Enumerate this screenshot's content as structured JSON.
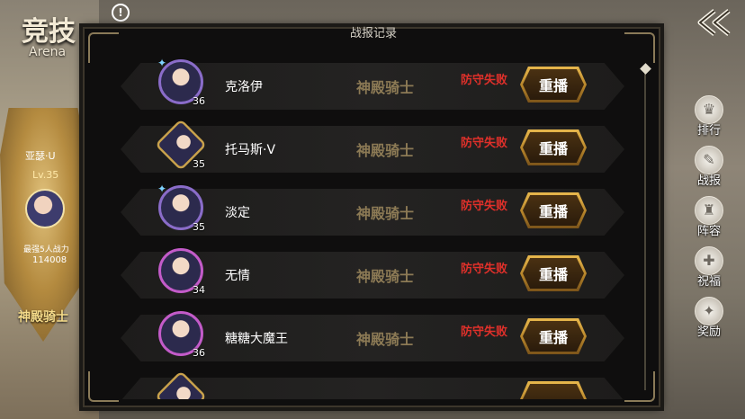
{
  "background": {
    "title": "竞技",
    "subtitle": "Arena",
    "opponent_name": "亚瑟·U",
    "opponent_level": "Lv.35",
    "power_label": "最强5人战力",
    "power_value": "114008",
    "rank_title": "神殿骑士"
  },
  "side_menu": [
    {
      "label": "排行",
      "icon": "ranking-icon",
      "glyph": "♛"
    },
    {
      "label": "战报",
      "icon": "battle-report-icon",
      "glyph": "✎"
    },
    {
      "label": "阵容",
      "icon": "lineup-icon",
      "glyph": "♜"
    },
    {
      "label": "祝福",
      "icon": "blessing-icon",
      "glyph": "✚"
    },
    {
      "label": "奖励",
      "icon": "reward-icon",
      "glyph": "✦"
    }
  ],
  "dialog": {
    "title": "战报记录",
    "replay_label": "重播",
    "records": [
      {
        "name": "克洛伊",
        "level": "36",
        "rank": "神殿骑士",
        "result": "防守失败",
        "frame": "purple"
      },
      {
        "name": "托马斯·V",
        "level": "35",
        "rank": "神殿骑士",
        "result": "防守失败",
        "frame": "gold"
      },
      {
        "name": "淡定",
        "level": "35",
        "rank": "神殿骑士",
        "result": "防守失败",
        "frame": "purple"
      },
      {
        "name": "无情",
        "level": "34",
        "rank": "神殿骑士",
        "result": "防守失败",
        "frame": "pink"
      },
      {
        "name": "糖糖大魔王",
        "level": "36",
        "rank": "神殿骑士",
        "result": "防守失败",
        "frame": "pink"
      }
    ]
  },
  "colors": {
    "result": "#e0302a",
    "rank": "#8c7a55",
    "replay_gold": "#e8b84d"
  }
}
